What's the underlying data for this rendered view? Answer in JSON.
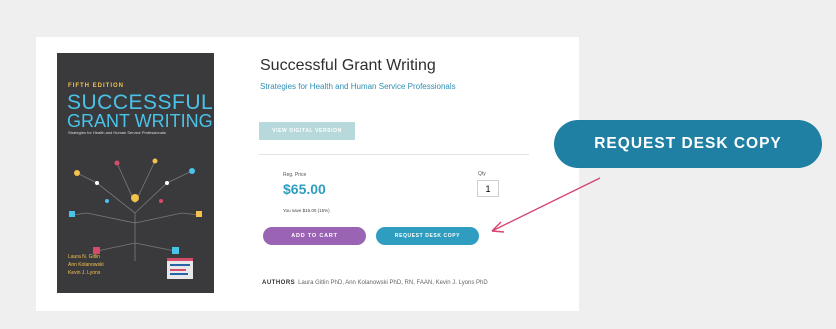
{
  "book": {
    "cover": {
      "edition": "FIFTH EDITION",
      "title_line1": "SUCCESSFUL",
      "title_line2": "GRANT WRITING",
      "subtitle": "Strategies for Health and Human Service Professionals",
      "authors": [
        "Laura N. Gitlin",
        "Ann Kolanowski",
        "Kevin J. Lyons"
      ]
    },
    "title": "Successful Grant Writing",
    "subtitle": "Strategies for Health and Human Service Professionals"
  },
  "actions": {
    "digital_label": "VIEW DIGITAL VERSION",
    "add_to_cart": "ADD TO CART",
    "desk_copy": "REQUEST DESK COPY"
  },
  "pricing": {
    "reg_price_label": "Reg. Price",
    "price": "$65.00",
    "you_save": "You save $15.00 (15%)",
    "qty_label": "Qty",
    "qty_value": "1"
  },
  "authors": {
    "label": "AUTHORS",
    "names": "Laura Gitlin PhD, Ann Kolanowski PhD, RN, FAAN, Kevin J. Lyons PhD"
  },
  "callout": {
    "label": "REQUEST DESK COPY"
  },
  "colors": {
    "accent_blue": "#2f9dbf",
    "callout_blue": "#1f80a3",
    "cart_purple": "#9b63b4",
    "arrow_pink": "#d6456f",
    "cover_bg": "#3a3a3d"
  }
}
